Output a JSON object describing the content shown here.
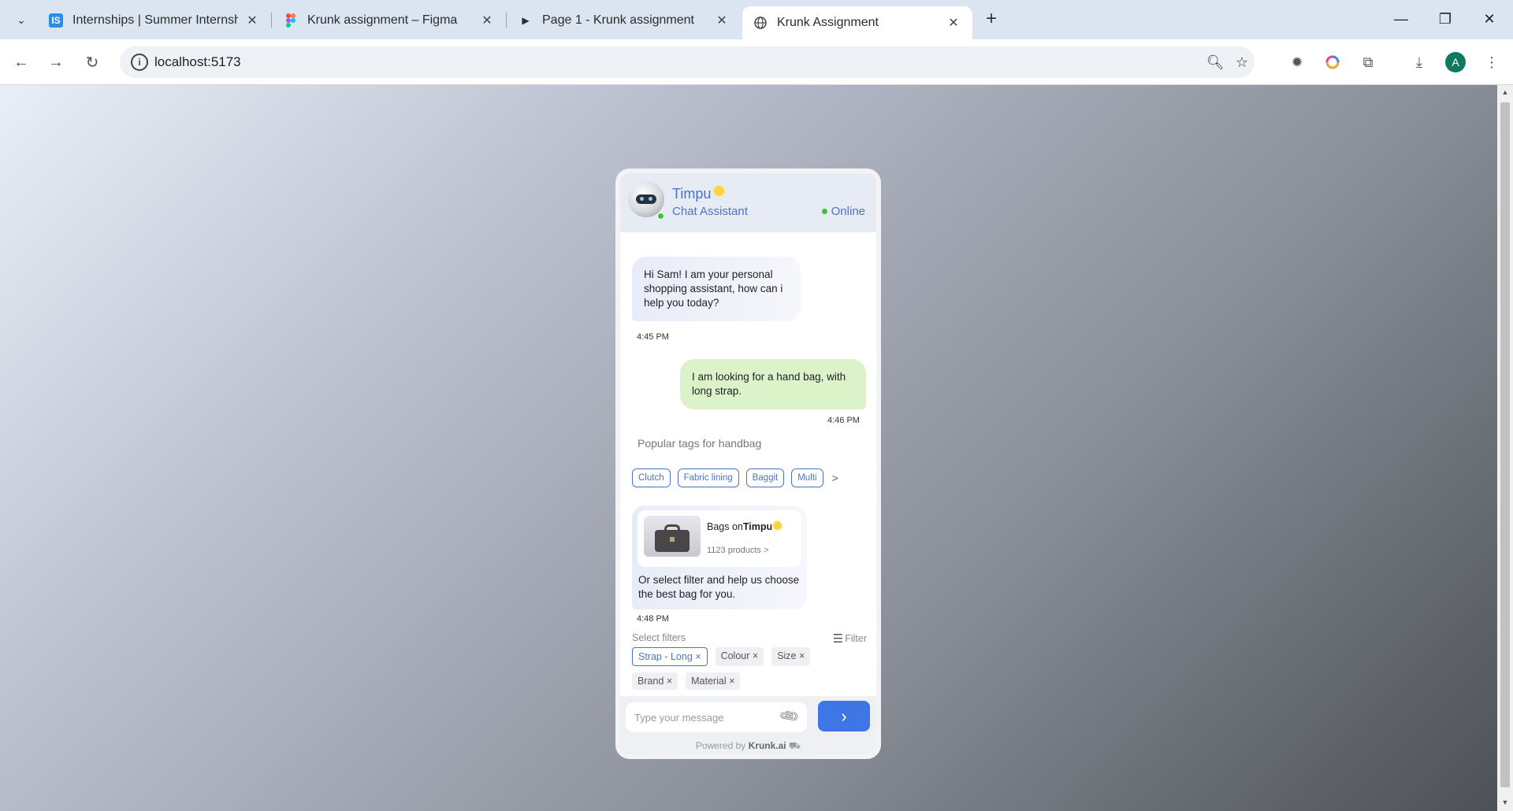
{
  "browser": {
    "tabs": [
      {
        "title": "Internships | Summer Internship",
        "favicon": "IS",
        "active": false
      },
      {
        "title": "Krunk assignment – Figma",
        "favicon": "figma-icon",
        "active": false
      },
      {
        "title": "Page 1 - Krunk assignment",
        "favicon": "play-icon",
        "active": false
      },
      {
        "title": "Krunk Assignment",
        "favicon": "globe-icon",
        "active": true
      }
    ],
    "url": "localhost:5173",
    "profile_initial": "A"
  },
  "chat": {
    "bot_name": "Timpu",
    "bot_role": "Chat Assistant",
    "status": "Online",
    "messages": [
      {
        "from": "bot",
        "text": "Hi Sam! I am your personal shopping assistant, how can i help you today?",
        "time": "4:45 PM"
      },
      {
        "from": "user",
        "text": "I am looking for a hand bag, with long strap.",
        "time": "4:46 PM"
      }
    ],
    "tags_title": "Popular tags for handbag",
    "tags": [
      "Clutch",
      "Fabric lining",
      "Baggit",
      "Multi"
    ],
    "tags_more": ">",
    "product": {
      "name_prefix": "Bags on",
      "name_brand": "Timpu",
      "count": "1123 products >",
      "text": "Or select filter and help us choose the best bag for you.",
      "time": "4:48 PM"
    },
    "filters_label": "Select filters",
    "filter_button": "Filter",
    "filters": [
      {
        "label": "Strap - Long ×",
        "selected": true
      },
      {
        "label": "Colour ×",
        "selected": false
      },
      {
        "label": "Size ×",
        "selected": false
      },
      {
        "label": "Brand ×",
        "selected": false
      },
      {
        "label": "Material ×",
        "selected": false
      }
    ],
    "input_placeholder": "Type your message",
    "powered_prefix": "Powered by",
    "powered_brand": "Krunk.ai"
  },
  "colors": {
    "accent": "#4d73c9",
    "send": "#3f76e6",
    "user_bubble": "#dcf3c9",
    "online": "#3cc13b"
  }
}
